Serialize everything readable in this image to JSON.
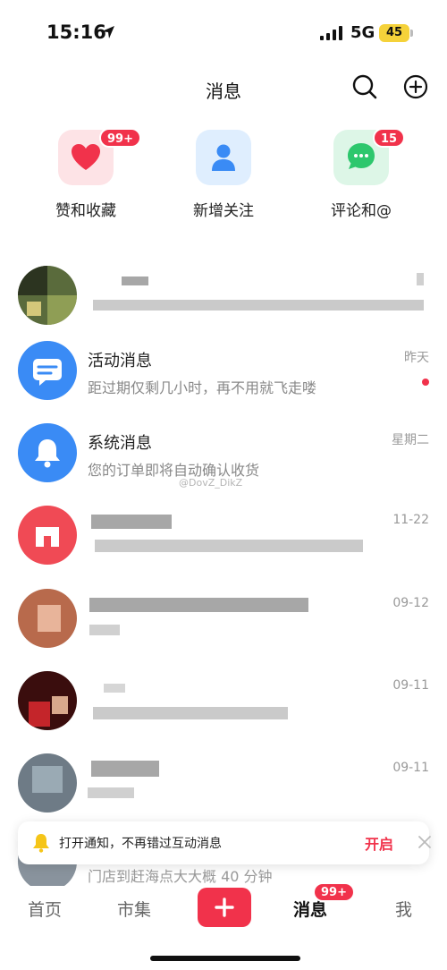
{
  "status_bar": {
    "time": "15:16",
    "network": "5G",
    "battery": "45"
  },
  "header": {
    "title": "消息"
  },
  "quick_actions": [
    {
      "label": "赞和收藏",
      "badge": "99+",
      "icon": "heart-icon",
      "color": "#f1324b"
    },
    {
      "label": "新增关注",
      "badge": "",
      "icon": "person-icon",
      "color": "#3a8bf5"
    },
    {
      "label": "评论和@",
      "badge": "15",
      "icon": "chat-bubble-icon",
      "color": "#2dc76d"
    }
  ],
  "messages": [
    {
      "title": "",
      "subtitle": "",
      "time": "",
      "redacted": true
    },
    {
      "title": "活动消息",
      "subtitle": "距过期仅剩几小时，再不用就飞走喽",
      "time": "昨天",
      "unread": true
    },
    {
      "title": "系统消息",
      "subtitle": "您的订单即将自动确认收货",
      "time": "星期二"
    },
    {
      "title": "",
      "subtitle": "",
      "time": "11-22",
      "redacted": true
    },
    {
      "title": "",
      "subtitle": "",
      "time": "09-12",
      "redacted": true
    },
    {
      "title": "",
      "subtitle": "",
      "time": "09-11",
      "redacted": true
    },
    {
      "title": "",
      "subtitle": "",
      "time": "09-11",
      "redacted": true
    }
  ],
  "watermark": "@DovZ_DikZ",
  "notification_prompt": {
    "text": "打开通知，不再错过互动消息",
    "action": "开启"
  },
  "peek_row": {
    "subtitle": "门店到赶海点大大概 40 分钟"
  },
  "tab_bar": {
    "home": "首页",
    "market": "市集",
    "messages": "消息",
    "messages_badge": "99+",
    "me": "我"
  },
  "colors": {
    "accent": "#f1324b",
    "blue": "#3a8bf5",
    "green": "#2dc76d"
  }
}
